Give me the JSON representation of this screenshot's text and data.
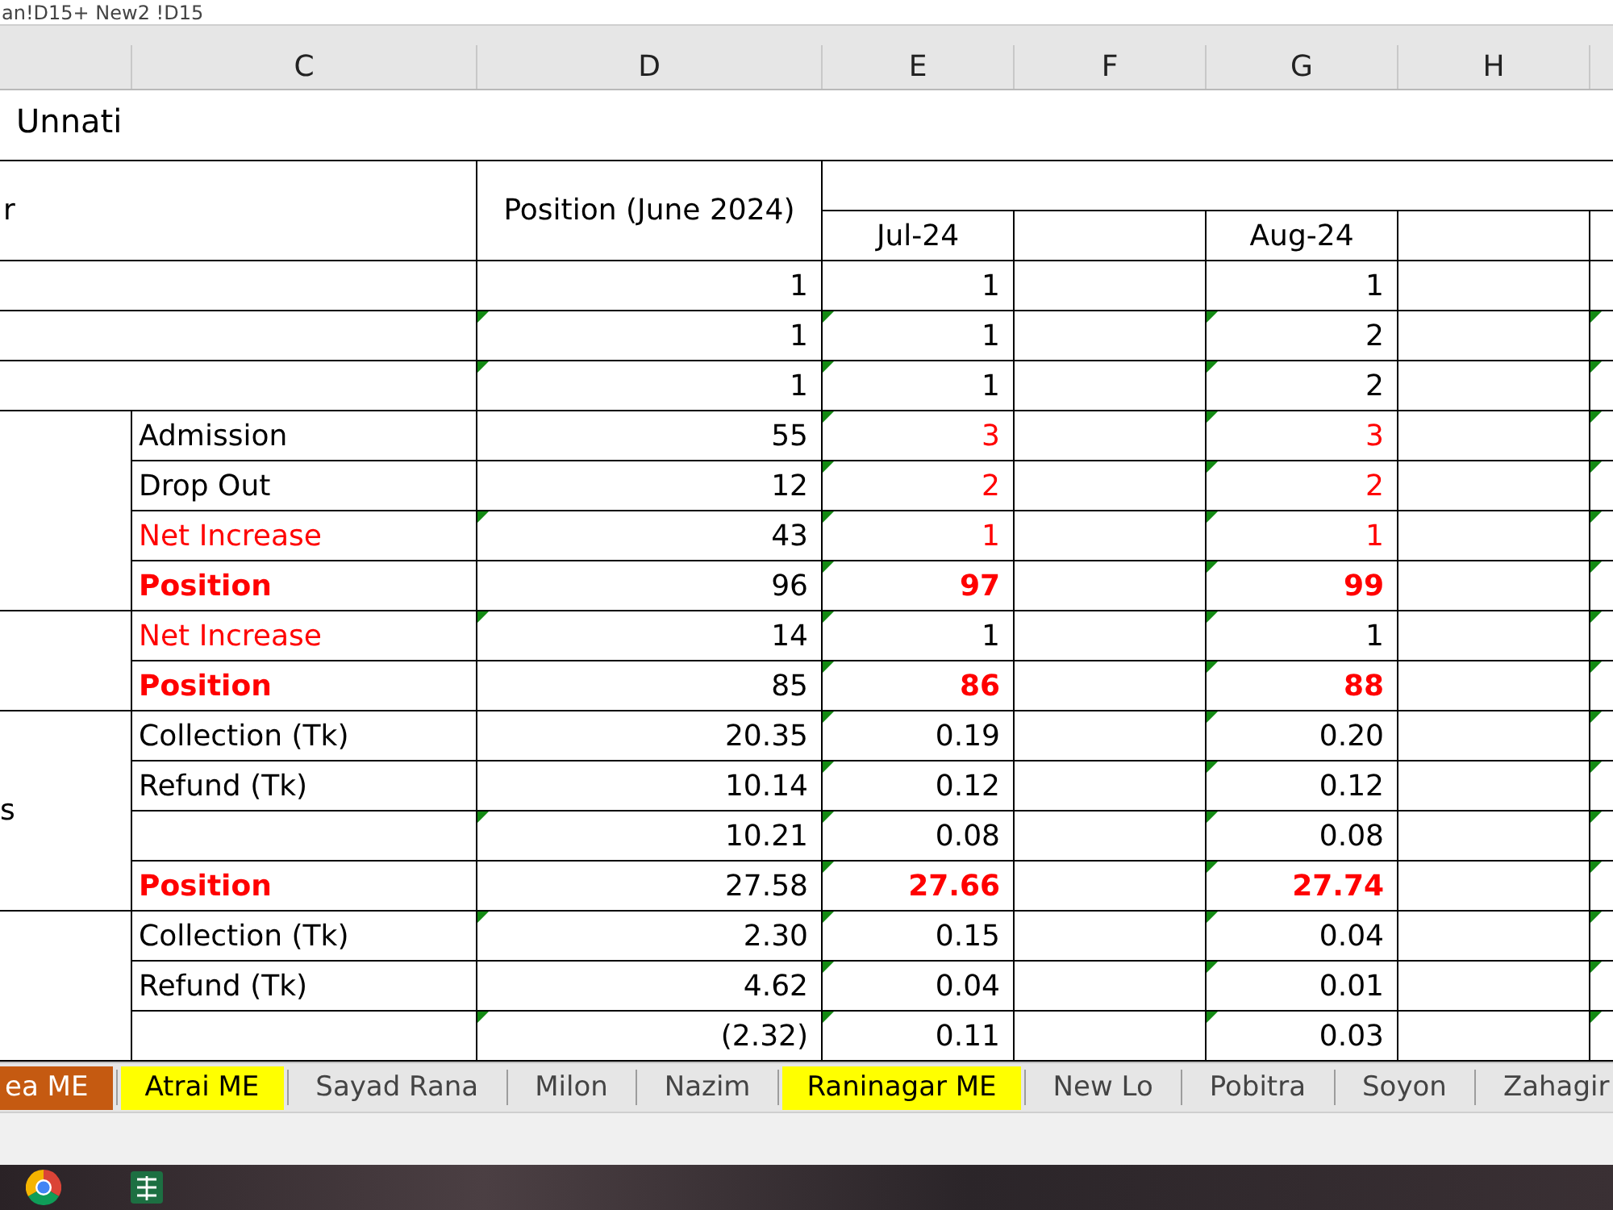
{
  "formula_bar": {
    "text": "an!D15+ New2 !D15"
  },
  "column_letters": [
    "C",
    "D",
    "E",
    "F",
    "G",
    "H"
  ],
  "title": "Unnati",
  "header": {
    "label": "r",
    "position_heading": "Position (June 2024)",
    "months": [
      "Jul-24",
      "Aug-24"
    ]
  },
  "sections": [
    {
      "kind": "merged",
      "rows": [
        {
          "values_highlighted": false,
          "values_bold": false,
          "position": {
            "text": "1",
            "flagged": false
          },
          "months": [
            {
              "text": "1",
              "flagged": false
            },
            {
              "text": "1",
              "flagged": false
            }
          ],
          "next_flagged": false
        },
        {
          "values_highlighted": false,
          "values_bold": false,
          "position": {
            "text": "1",
            "flagged": true
          },
          "months": [
            {
              "text": "1",
              "flagged": true
            },
            {
              "text": "2",
              "flagged": true
            }
          ],
          "next_flagged": true
        },
        {
          "values_highlighted": false,
          "values_bold": false,
          "position": {
            "text": "1",
            "flagged": true
          },
          "months": [
            {
              "text": "1",
              "flagged": true
            },
            {
              "text": "2",
              "flagged": true
            }
          ],
          "next_flagged": true
        }
      ]
    },
    {
      "kind": "grouped",
      "rows": [
        {
          "label": "Admission",
          "label_highlighted": false,
          "label_bold": false,
          "values_highlighted": true,
          "values_bold": false,
          "position": {
            "text": "55",
            "flagged": false
          },
          "months": [
            {
              "text": "3",
              "flagged": true
            },
            {
              "text": "3",
              "flagged": true
            }
          ],
          "next_flagged": true
        },
        {
          "label": "Drop Out",
          "label_highlighted": false,
          "label_bold": false,
          "values_highlighted": true,
          "values_bold": false,
          "position": {
            "text": "12",
            "flagged": false
          },
          "months": [
            {
              "text": "2",
              "flagged": true
            },
            {
              "text": "2",
              "flagged": true
            }
          ],
          "next_flagged": true
        },
        {
          "label": "Net Increase",
          "label_highlighted": true,
          "label_bold": false,
          "values_highlighted": true,
          "values_bold": false,
          "position": {
            "text": "43",
            "flagged": true
          },
          "months": [
            {
              "text": "1",
              "flagged": true
            },
            {
              "text": "1",
              "flagged": true
            }
          ],
          "next_flagged": true
        },
        {
          "label": "Position",
          "label_highlighted": true,
          "label_bold": true,
          "values_highlighted": true,
          "values_bold": true,
          "position": {
            "text": "96",
            "flagged": false
          },
          "months": [
            {
              "text": "97",
              "flagged": true
            },
            {
              "text": "99",
              "flagged": true
            }
          ],
          "next_flagged": true
        }
      ]
    },
    {
      "kind": "grouped",
      "rows": [
        {
          "label": "Net Increase",
          "label_highlighted": true,
          "label_bold": false,
          "values_highlighted": false,
          "values_bold": false,
          "position": {
            "text": "14",
            "flagged": true
          },
          "months": [
            {
              "text": "1",
              "flagged": true
            },
            {
              "text": "1",
              "flagged": true
            }
          ],
          "next_flagged": true
        },
        {
          "label": "Position",
          "label_highlighted": true,
          "label_bold": true,
          "values_highlighted": true,
          "values_bold": true,
          "position": {
            "text": "85",
            "flagged": false
          },
          "months": [
            {
              "text": "86",
              "flagged": true
            },
            {
              "text": "88",
              "flagged": true
            }
          ],
          "next_flagged": true
        }
      ]
    },
    {
      "kind": "grouped",
      "label": "s",
      "rows": [
        {
          "label": "Collection (Tk)",
          "label_highlighted": false,
          "label_bold": false,
          "values_highlighted": false,
          "values_bold": false,
          "position": {
            "text": "20.35",
            "flagged": false
          },
          "months": [
            {
              "text": "0.19",
              "flagged": true
            },
            {
              "text": "0.20",
              "flagged": true
            }
          ],
          "next_flagged": true
        },
        {
          "label": "Refund (Tk)",
          "label_highlighted": false,
          "label_bold": false,
          "values_highlighted": false,
          "values_bold": false,
          "position": {
            "text": "10.14",
            "flagged": false
          },
          "months": [
            {
              "text": "0.12",
              "flagged": true
            },
            {
              "text": "0.12",
              "flagged": true
            }
          ],
          "next_flagged": true
        },
        {
          "values_highlighted": false,
          "values_bold": false,
          "position": {
            "text": "10.21",
            "flagged": true
          },
          "months": [
            {
              "text": "0.08",
              "flagged": true
            },
            {
              "text": "0.08",
              "flagged": true
            }
          ],
          "next_flagged": true
        },
        {
          "label": "Position",
          "label_highlighted": true,
          "label_bold": true,
          "values_highlighted": true,
          "values_bold": true,
          "position": {
            "text": "27.58",
            "flagged": false
          },
          "months": [
            {
              "text": "27.66",
              "flagged": true
            },
            {
              "text": "27.74",
              "flagged": true
            }
          ],
          "next_flagged": true
        }
      ]
    },
    {
      "kind": "grouped",
      "rows": [
        {
          "label": "Collection (Tk)",
          "label_highlighted": false,
          "label_bold": false,
          "values_highlighted": false,
          "values_bold": false,
          "position": {
            "text": "2.30",
            "flagged": true
          },
          "months": [
            {
              "text": "0.15",
              "flagged": true
            },
            {
              "text": "0.04",
              "flagged": true
            }
          ],
          "next_flagged": true
        },
        {
          "label": "Refund (Tk)",
          "label_highlighted": false,
          "label_bold": false,
          "values_highlighted": false,
          "values_bold": false,
          "position": {
            "text": "4.62",
            "flagged": false
          },
          "months": [
            {
              "text": "0.04",
              "flagged": true
            },
            {
              "text": "0.01",
              "flagged": true
            }
          ],
          "next_flagged": true
        },
        {
          "values_highlighted": false,
          "values_bold": false,
          "position": {
            "text": "(2.32)",
            "flagged": true
          },
          "months": [
            {
              "text": "0.11",
              "flagged": true
            },
            {
              "text": "0.03",
              "flagged": true
            }
          ],
          "next_flagged": true
        }
      ]
    }
  ],
  "sheet_tabs": [
    {
      "label": "ea ME",
      "color": "#c55a11",
      "selected": false
    },
    {
      "label": "Atrai ME",
      "color": "#ffff00",
      "selected": false
    },
    {
      "label": "Sayad Rana",
      "selected": false
    },
    {
      "label": "Milon",
      "selected": false
    },
    {
      "label": "Nazim",
      "selected": false
    },
    {
      "label": "Raninagar ME",
      "color": "#ffff00",
      "selected": false
    },
    {
      "label": "New Lo",
      "selected": false
    },
    {
      "label": "Pobitra",
      "selected": false
    },
    {
      "label": "Soyon",
      "selected": false
    },
    {
      "label": "Zahagir",
      "selected": false
    }
  ]
}
